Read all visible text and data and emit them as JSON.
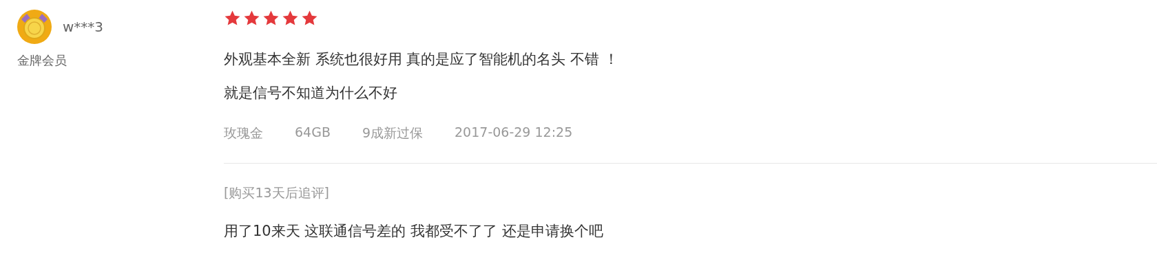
{
  "user": {
    "name": "w***3",
    "level": "金牌会员"
  },
  "review": {
    "stars": 5,
    "lines": [
      "外观基本全新 系统也很好用 真的是应了智能机的名头 不错 ！",
      "就是信号不知道为什么不好"
    ],
    "meta": [
      "玫瑰金",
      "64GB",
      "9成新过保",
      "2017-06-29 12:25"
    ]
  },
  "followup": {
    "label": "[购买13天后追评]",
    "text": "用了10来天 这联通信号差的 我都受不了了 还是申请换个吧"
  }
}
